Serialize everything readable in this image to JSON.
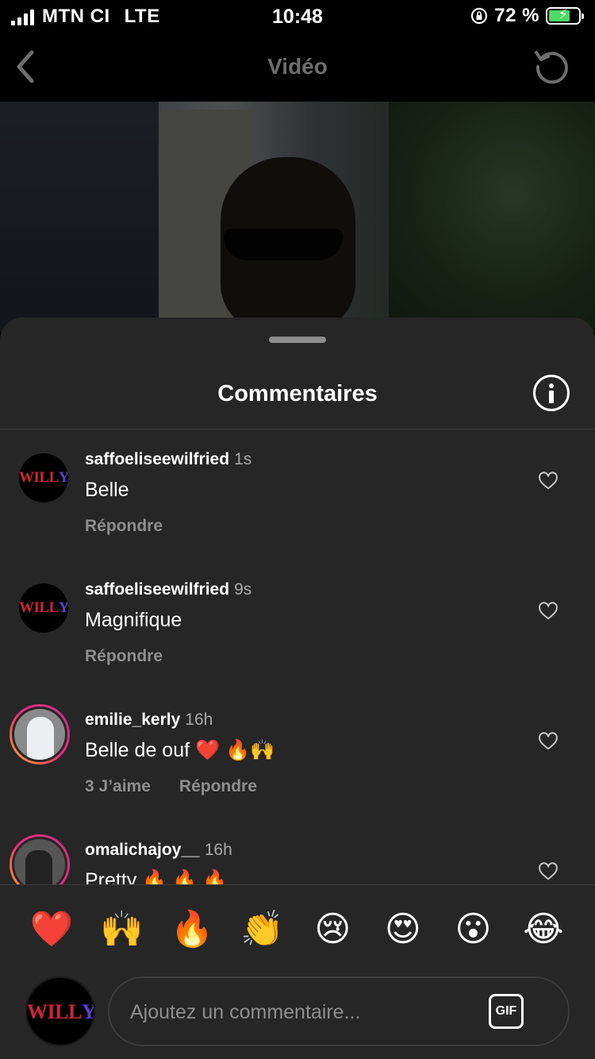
{
  "status_bar": {
    "carrier": "MTN CI",
    "network": "LTE",
    "time": "10:48",
    "battery_percent": "72 %",
    "battery_level": 0.72
  },
  "nav": {
    "title": "Vidéo",
    "back_icon": "chevron-left-icon",
    "reload_icon": "reload-icon"
  },
  "sheet": {
    "title": "Commentaires",
    "info_icon": "info-icon"
  },
  "comments": [
    {
      "username": "saffoeliseewilfried",
      "time": "1s",
      "text": "Belle",
      "likes": "",
      "reply": "Répondre"
    },
    {
      "username": "saffoeliseewilfried",
      "time": "9s",
      "text": "Magnifique",
      "likes": "",
      "reply": "Répondre"
    },
    {
      "username": "emilie_kerly",
      "time": "16h",
      "text": "Belle de ouf ❤️ 🔥🙌",
      "likes": "3 J’aime",
      "reply": "Répondre"
    },
    {
      "username": "omalichajoy__",
      "time": "16h",
      "text": "Pretty 🔥 🔥 🔥",
      "likes": "",
      "reply": ""
    }
  ],
  "avatar_logo": {
    "main": "WILL",
    "accent": "Y"
  },
  "emoji_reactions": [
    "❤️",
    "🙌",
    "🔥",
    "👏",
    "😢",
    "😍",
    "😮",
    "😂"
  ],
  "composer": {
    "placeholder": "Ajoutez un commentaire...",
    "gif_label": "GIF"
  },
  "colors": {
    "background": "#262626",
    "secondary_text": "#8e8e8e",
    "battery_green": "#4cd964"
  }
}
